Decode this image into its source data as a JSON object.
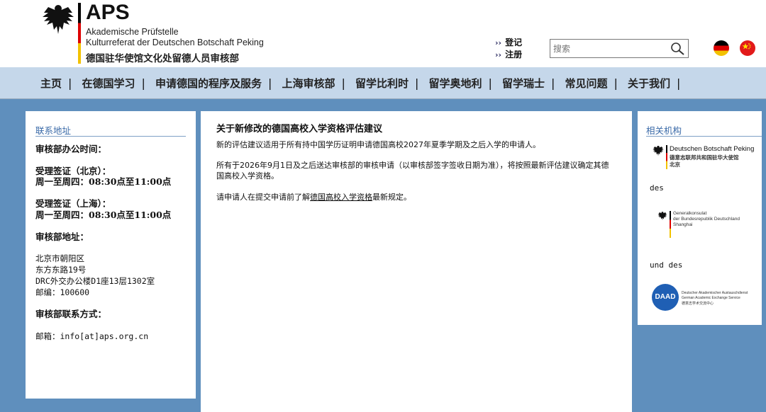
{
  "header": {
    "logo_abbr": "APS",
    "logo_line1": "Akademische Prüfstelle",
    "logo_line2": "Kulturreferat der Deutschen Botschaft Peking",
    "logo_line3": "德国驻华使馆文化处留德人员审核部",
    "login_label": "登记",
    "register_label": "注册",
    "search_placeholder": "搜索"
  },
  "nav": {
    "items": [
      "主页",
      "在德国学习",
      "申请德国的程序及服务",
      "上海审核部",
      "留学比利时",
      "留学奥地利",
      "留学瑞士",
      "常见问题",
      "关于我们"
    ]
  },
  "left": {
    "title": "联系地址",
    "hours_heading": "审核部办公时间：",
    "beijing_heading": "受理签证（北京）：",
    "beijing_hours": "周一至周四：08:30点至11:00点",
    "shanghai_heading": "受理签证（上海）：",
    "shanghai_hours": "周一至周四：08:30点至11:00点",
    "address_heading": "审核部地址：",
    "address_lines": [
      "北京市朝阳区",
      "东方东路19号",
      "DRC外交办公楼D1座13层1302室",
      "邮编：100600"
    ],
    "contact_heading": "审核部联系方式：",
    "email": "邮箱：info[at]aps.org.cn"
  },
  "center": {
    "title": "关于新修改的德国高校入学资格评估建议",
    "p1": "新的评估建议适用于所有持中国学历证明申请德国高校2027年夏季学期及之后入学的申请人。",
    "p2": "所有于2026年9月1日及之后送达审核部的审核申请（以审核部签字签收日期为准），将按照最新评估建议确定其德国高校入学资格。",
    "p3_before": "请申请人在提交申请前了解",
    "p3_link": "德国高校入学资格",
    "p3_after": "最新规定。"
  },
  "right": {
    "title": "相关机构",
    "org1_name": "Deutschen Botschaft Peking",
    "org1_cn": "德意志联邦共和国驻华大使馆",
    "org1_city": "北京",
    "des": "des",
    "org2_line1": "Generalkonsulat",
    "org2_line2": "der Bundesrepublik Deutschland",
    "org2_line3": "Shanghai",
    "und_des": "und des",
    "daad_abbr": "DAAD",
    "daad_line1": "Deutscher Akademischer Austauschdienst",
    "daad_line2": "German Academic Exchange Service",
    "daad_line3": "德意志学术交流中心"
  },
  "colors": {
    "page_bg": "#5f8fbd",
    "nav_bg": "#c5d7ea",
    "panel_title": "#3a6aa8",
    "daad_blue": "#1f5fb4"
  }
}
